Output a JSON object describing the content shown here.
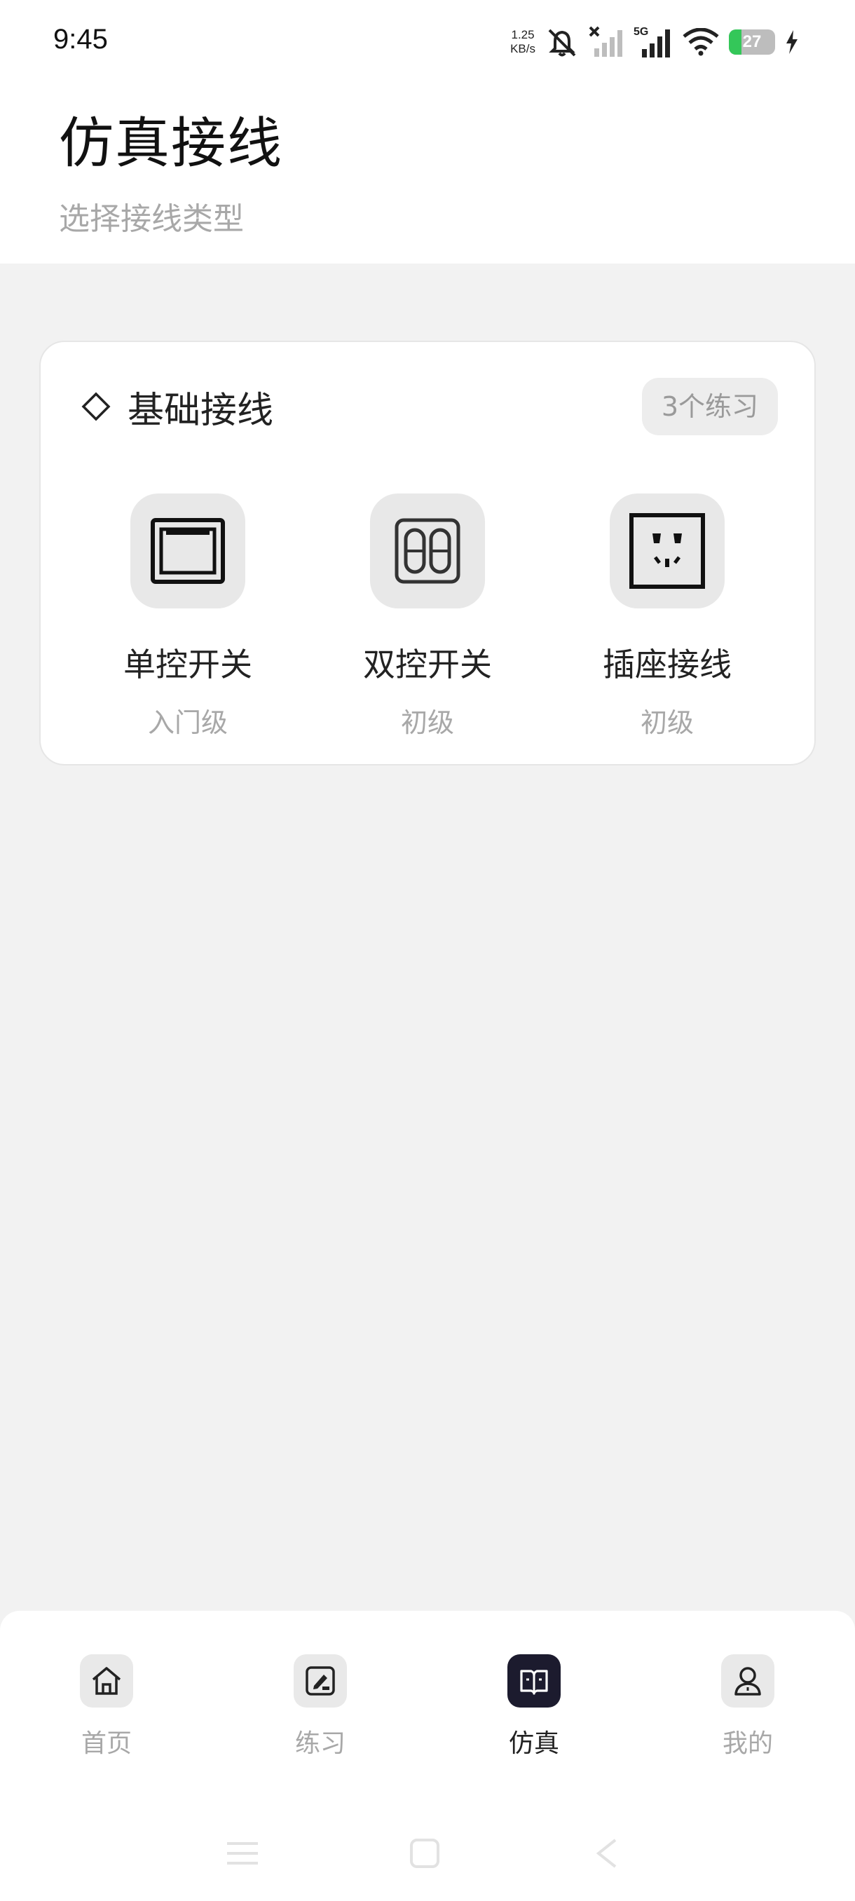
{
  "status_bar": {
    "time": "9:45",
    "net_speed_value": "1.25",
    "net_speed_unit": "KB/s",
    "network_type": "5G",
    "battery_level": "27",
    "battery_fraction": 0.27,
    "icons": [
      "mute-bell-icon",
      "signal-no-service-icon",
      "signal-5g-icon",
      "wifi-icon",
      "battery-icon",
      "charging-bolt-icon"
    ]
  },
  "header": {
    "title": "仿真接线",
    "subtitle": "选择接线类型"
  },
  "section": {
    "title": "基础接线",
    "badge": "3个练习",
    "title_icon": "diamond-outline-icon",
    "items": [
      {
        "name": "单控开关",
        "level": "入门级",
        "icon": "single-switch-icon"
      },
      {
        "name": "双控开关",
        "level": "初级",
        "icon": "double-switch-icon"
      },
      {
        "name": "插座接线",
        "level": "初级",
        "icon": "socket-icon"
      }
    ]
  },
  "bottom_nav": {
    "items": [
      {
        "label": "首页",
        "icon": "home-icon",
        "active": false
      },
      {
        "label": "练习",
        "icon": "practice-edit-icon",
        "active": false
      },
      {
        "label": "仿真",
        "icon": "simulation-book-icon",
        "active": true
      },
      {
        "label": "我的",
        "icon": "profile-user-icon",
        "active": false
      }
    ]
  },
  "colors": {
    "page_background": "#f2f2f2",
    "active_nav": "#1c1b2e",
    "muted_text": "#a8a8a8",
    "battery_green": "#34c759"
  }
}
